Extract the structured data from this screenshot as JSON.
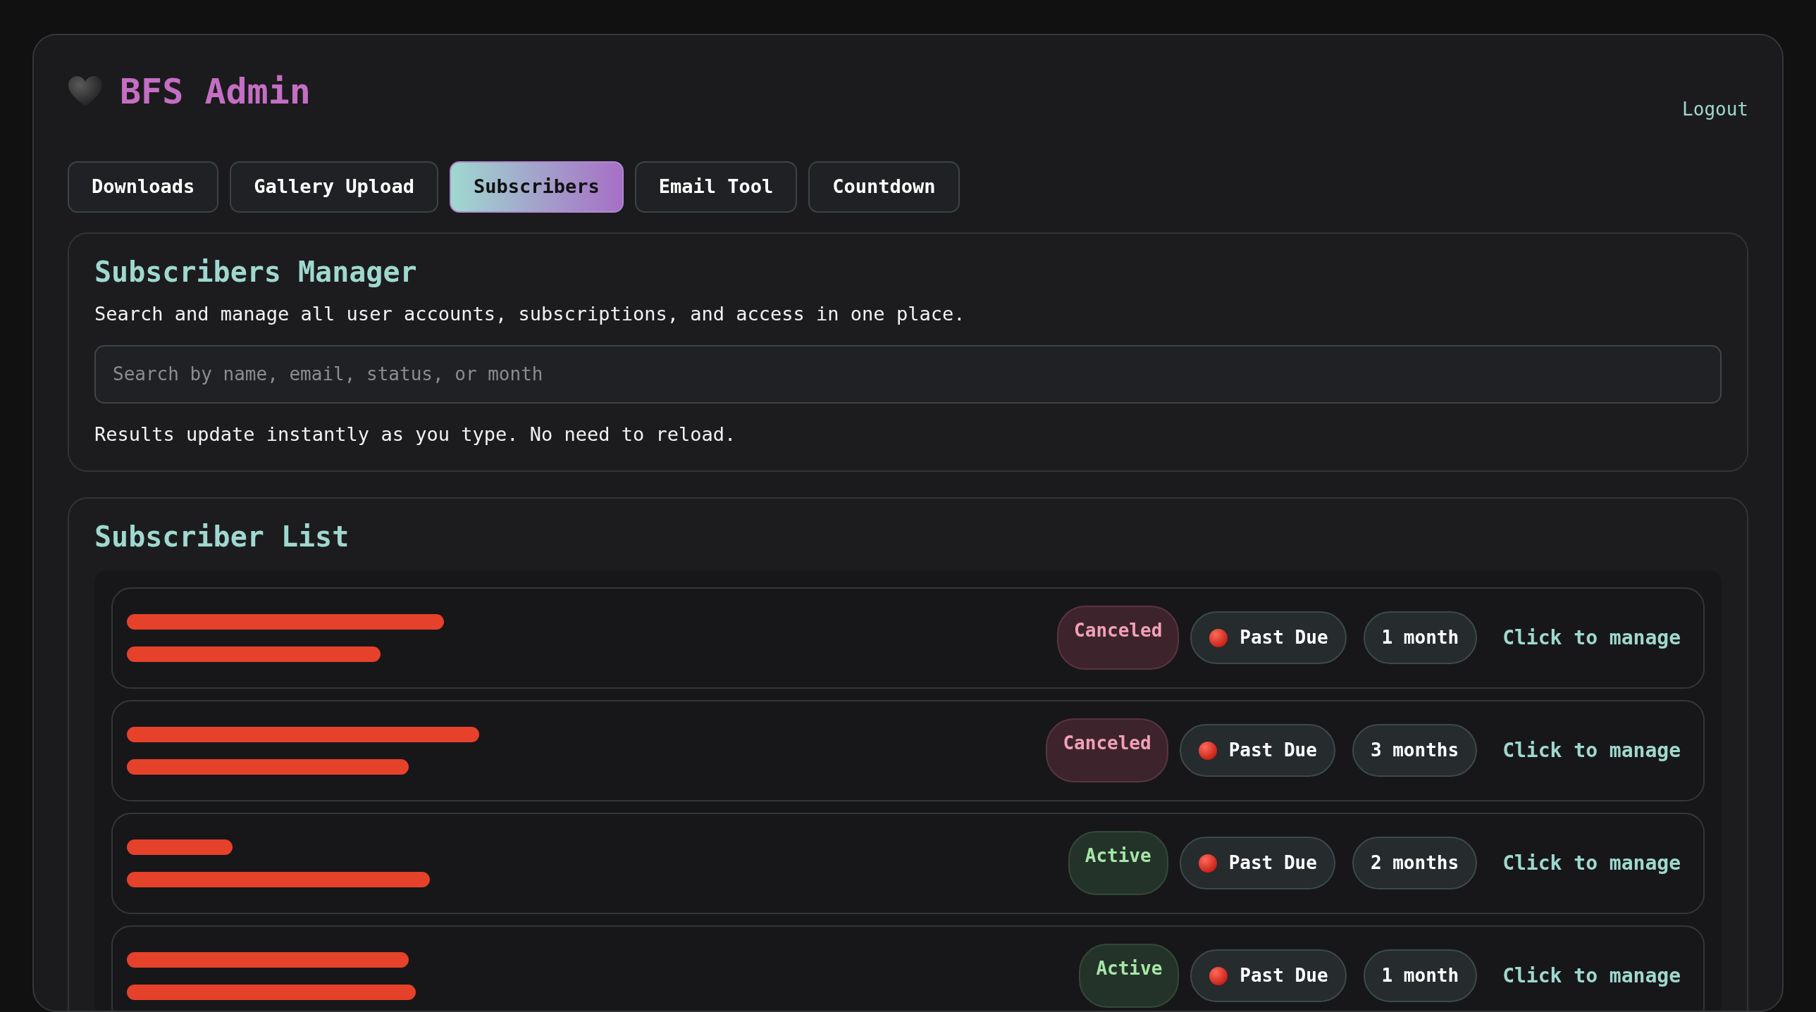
{
  "header": {
    "title": "BFS Admin",
    "logout": "Logout"
  },
  "tabs": [
    {
      "label": "Downloads",
      "selected": false
    },
    {
      "label": "Gallery Upload",
      "selected": false
    },
    {
      "label": "Subscribers",
      "selected": true
    },
    {
      "label": "Email Tool",
      "selected": false
    },
    {
      "label": "Countdown",
      "selected": false
    }
  ],
  "manager": {
    "title": "Subscribers Manager",
    "description": "Search and manage all user accounts, subscriptions, and access in one place.",
    "search": {
      "placeholder": "Search by name, email, status, or month"
    },
    "hint": "Results update instantly as you type. No need to reload."
  },
  "list": {
    "title": "Subscriber List",
    "rows": [
      {
        "status": {
          "label": "Canceled",
          "kind": "canceled"
        },
        "payment": {
          "label": "Past Due",
          "kind": "past_due"
        },
        "duration": "1 month",
        "action": "Click to manage"
      },
      {
        "status": {
          "label": "Canceled",
          "kind": "canceled"
        },
        "payment": {
          "label": "Past Due",
          "kind": "past_due"
        },
        "duration": "3 months",
        "action": "Click to manage"
      },
      {
        "status": {
          "label": "Active",
          "kind": "active"
        },
        "payment": {
          "label": "Past Due",
          "kind": "past_due"
        },
        "duration": "2 months",
        "action": "Click to manage"
      },
      {
        "status": {
          "label": "Active",
          "kind": "active"
        },
        "payment": {
          "label": "Past Due",
          "kind": "past_due"
        },
        "duration": "1 month",
        "action": "Click to manage"
      }
    ]
  }
}
